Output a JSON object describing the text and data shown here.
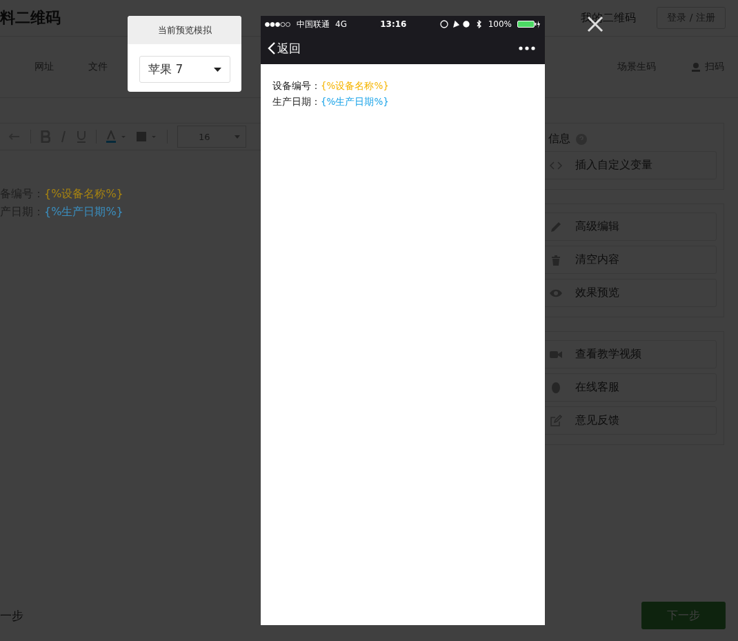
{
  "header": {
    "logo": "料二维码",
    "nav": [
      "我的二维码"
    ],
    "login": "登录 / 注册"
  },
  "tabs": [
    "网址",
    "文件"
  ],
  "side_tabs": [
    {
      "kind": "text",
      "label": "场景生码"
    },
    {
      "kind": "scan",
      "label": "扫码"
    }
  ],
  "toolbar": {
    "font_size": "16"
  },
  "editor": {
    "lines": [
      {
        "label": "备编号：",
        "value": "{%设备名称%}",
        "color": "#a88410"
      },
      {
        "label": "产日期：",
        "value": "{%生产日期%}",
        "color": "#3a8fc0"
      }
    ]
  },
  "panel": {
    "title": "信息",
    "groups": [
      [
        {
          "kind": "code",
          "label": "插入自定义变量"
        }
      ],
      [
        {
          "kind": "pencil",
          "label": "高级编辑"
        },
        {
          "kind": "trash",
          "label": "清空内容"
        },
        {
          "kind": "eye",
          "label": "效果预览"
        }
      ],
      [
        {
          "kind": "video",
          "label": "查看教学视频"
        },
        {
          "kind": "chat",
          "label": "在线客服"
        },
        {
          "kind": "edit",
          "label": "意见反馈"
        }
      ]
    ]
  },
  "footer": {
    "back": "一步",
    "next": "下一步"
  },
  "preview": {
    "title": "当前预览模拟",
    "device": "苹果 7"
  },
  "phone": {
    "carrier": "中国联通",
    "network": "4G",
    "time": "13:16",
    "battery": "100%",
    "back": "返回",
    "lines": [
      {
        "label": "设备编号：",
        "value": "{%设备名称%}",
        "color": "#f5b400"
      },
      {
        "label": "生产日期：",
        "value": "{%生产日期%}",
        "color": "#1aa3e8"
      }
    ]
  }
}
